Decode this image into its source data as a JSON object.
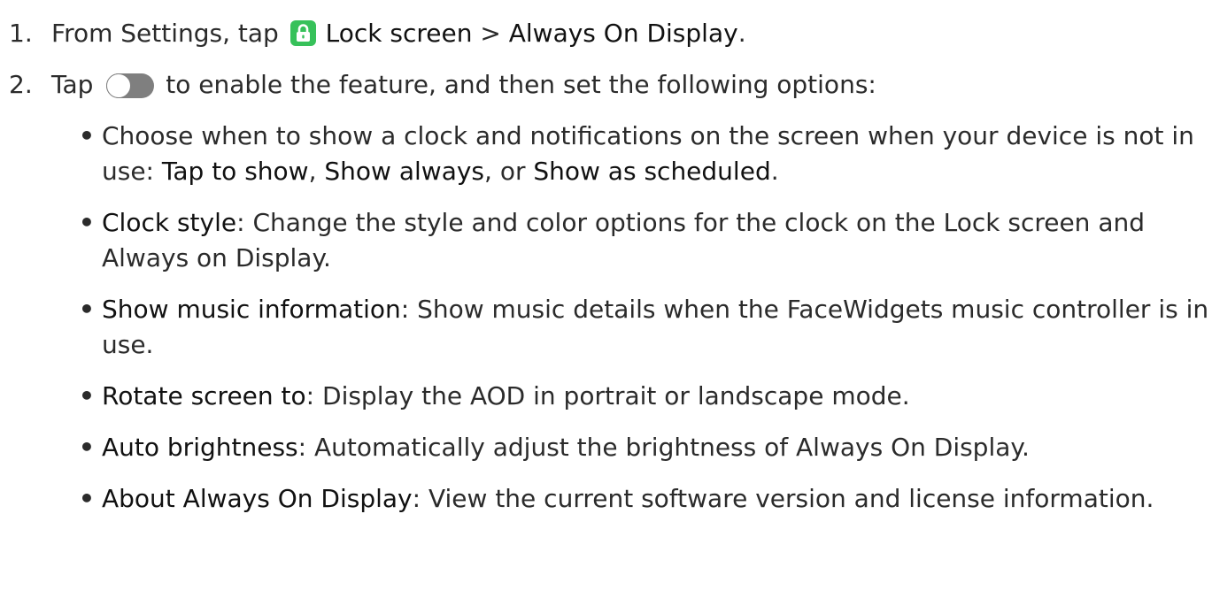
{
  "steps": [
    {
      "number": "1.",
      "prefix": "From Settings, tap ",
      "target1": "Lock screen",
      "separator": " > ",
      "target2": "Always On Display",
      "suffix": "."
    },
    {
      "number": "2.",
      "prefix": "Tap ",
      "suffix": " to enable the feature, and then set the following options:"
    }
  ],
  "options": [
    {
      "bullet": "•",
      "text_before": "Choose when to show a clock and notifications on the screen when your device is not in use: ",
      "choice1": "Tap to show",
      "sep1": ", ",
      "choice2": "Show always",
      "sep2": ", or ",
      "choice3": "Show as scheduled",
      "end": "."
    },
    {
      "bullet": "•",
      "term": "Clock style",
      "description": ": Change the style and color options for the clock on the Lock screen and Always on Display."
    },
    {
      "bullet": "•",
      "term": "Show music information",
      "description": ": Show music details when the FaceWidgets music controller is in use."
    },
    {
      "bullet": "•",
      "term": "Rotate screen to",
      "description": ": Display the AOD in portrait or landscape mode."
    },
    {
      "bullet": "•",
      "term": "Auto brightness",
      "description": ": Automatically adjust the brightness of Always On Display."
    },
    {
      "bullet": "•",
      "term": "About Always On Display",
      "description": ": View the current software version and license information."
    }
  ],
  "icons": {
    "lock": "lock-screen-icon",
    "toggle": "toggle-switch-icon"
  },
  "colors": {
    "text": "#2b2b2b",
    "lock_icon_bg": "#37c15a",
    "toggle": "#7f7f7f"
  }
}
